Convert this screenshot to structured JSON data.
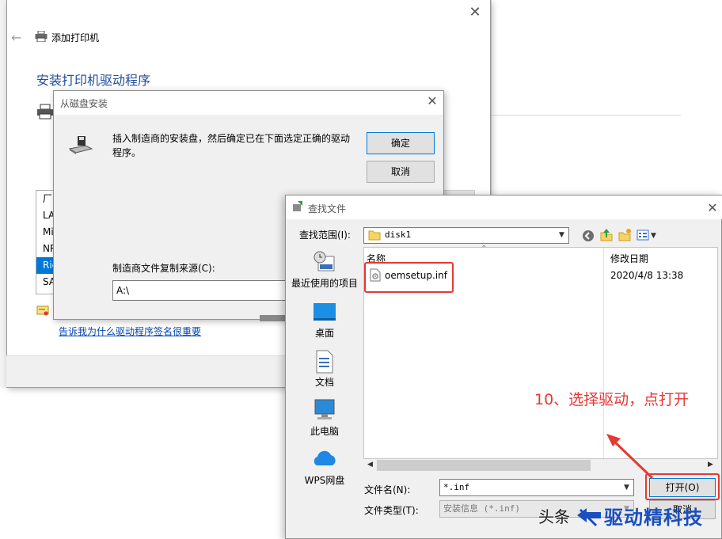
{
  "wizard": {
    "title": "添加打印机",
    "heading": "安装打印机驱动程序",
    "manufacturers": [
      "厂",
      "LA",
      "Mi",
      "NR",
      "Ric",
      "SA"
    ],
    "selected_index": 4,
    "signing_link": "告诉我为什么驱动程序签名很重要"
  },
  "disk_dialog": {
    "title": "从磁盘安装",
    "message": "插入制造商的安装盘，然后确定已在下面选定正确的驱动程序。",
    "ok_label": "确定",
    "cancel_label": "取消",
    "copy_from_label": "制造商文件复制来源(C):",
    "copy_from_value": "A:\\"
  },
  "find_dialog": {
    "title": "查找文件",
    "look_in_label": "查找范围(I):",
    "look_in_value": "disk1",
    "places": [
      {
        "label": "最近使用的项目",
        "icon": "recent-icon"
      },
      {
        "label": "桌面",
        "icon": "desktop-icon"
      },
      {
        "label": "文档",
        "icon": "documents-icon"
      },
      {
        "label": "此电脑",
        "icon": "computer-icon"
      },
      {
        "label": "WPS网盘",
        "icon": "cloud-icon"
      }
    ],
    "columns": {
      "name": "名称",
      "modified": "修改日期"
    },
    "files": [
      {
        "name": "oemsetup.inf",
        "modified": "2020/4/8 13:38",
        "icon": "inf-file-icon"
      }
    ],
    "file_name_label": "文件名(N):",
    "file_name_value": "*.inf",
    "file_type_label": "文件类型(T):",
    "file_type_value": "安装信息 (*.inf)",
    "open_label": "打开(O)",
    "cancel_label": "取消"
  },
  "annotation": {
    "text": "10、选择驱动，点打开",
    "color": "#e53935"
  },
  "watermark": {
    "prefix": "头条",
    "brand": "驱动精科技"
  },
  "colors": {
    "accent": "#0078d7",
    "heading": "#1f4e9b",
    "link": "#0645ad"
  }
}
